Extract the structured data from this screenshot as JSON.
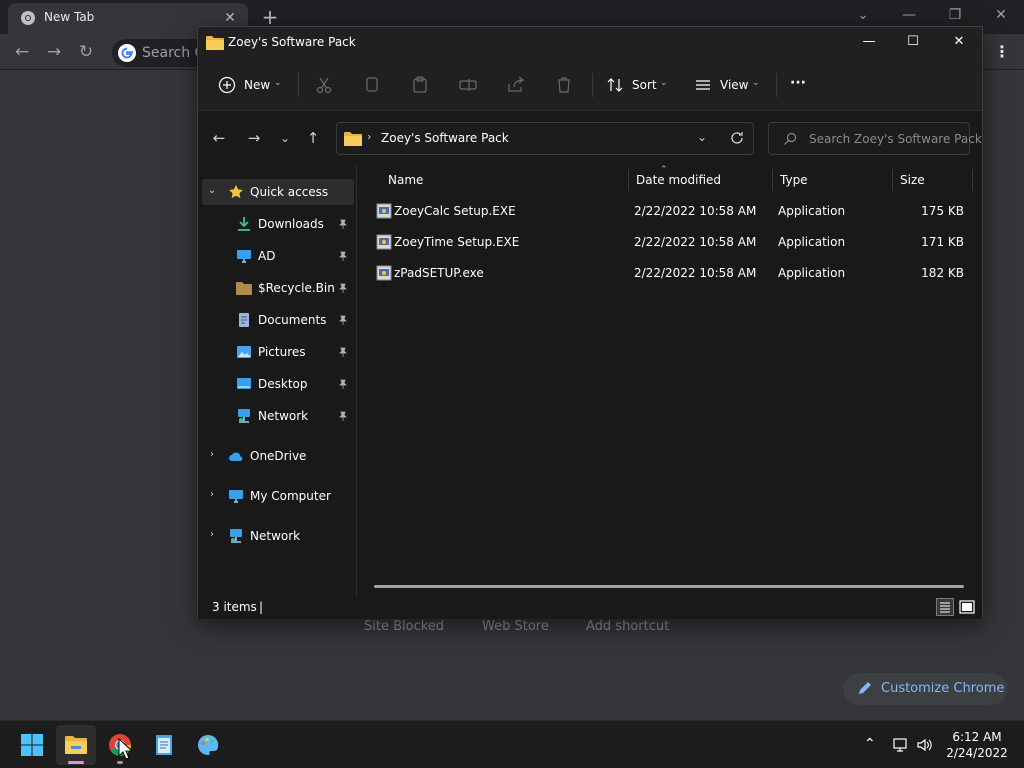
{
  "chrome": {
    "tab_title": "New Tab",
    "omnibox_placeholder": "Search Google or type a URL",
    "shortcuts": [
      "Site Blocked",
      "Web Store",
      "Add shortcut"
    ],
    "customize_label": "Customize Chrome"
  },
  "explorer": {
    "title": "Zoey's Software Pack",
    "commandbar": {
      "new_label": "New",
      "sort_label": "Sort",
      "view_label": "View",
      "more_label": "···"
    },
    "address": {
      "path": "Zoey's Software Pack",
      "search_placeholder": "Search Zoey's Software Pack"
    },
    "nav": {
      "quick_access": "Quick access",
      "pinned": [
        "Downloads",
        "AD",
        "$Recycle.Bin",
        "Documents",
        "Pictures",
        "Desktop",
        "Network"
      ],
      "roots": [
        "OneDrive",
        "My Computer",
        "Network"
      ]
    },
    "columns": {
      "name": "Name",
      "date": "Date modified",
      "type": "Type",
      "size": "Size"
    },
    "files": [
      {
        "name": "ZoeyCalc Setup.EXE",
        "date": "2/22/2022 10:58 AM",
        "type": "Application",
        "size": "175 KB"
      },
      {
        "name": "ZoeyTime Setup.EXE",
        "date": "2/22/2022 10:58 AM",
        "type": "Application",
        "size": "171 KB"
      },
      {
        "name": "zPadSETUP.exe",
        "date": "2/22/2022 10:58 AM",
        "type": "Application",
        "size": "182 KB"
      }
    ],
    "status": {
      "item_count": "3 items"
    }
  },
  "taskbar": {
    "time": "6:12 AM",
    "date": "2/24/2022"
  },
  "colors": {
    "accent_folder": "#f0c24b",
    "chrome_link": "#8ab4f8",
    "explorer_bg": "#191919"
  }
}
